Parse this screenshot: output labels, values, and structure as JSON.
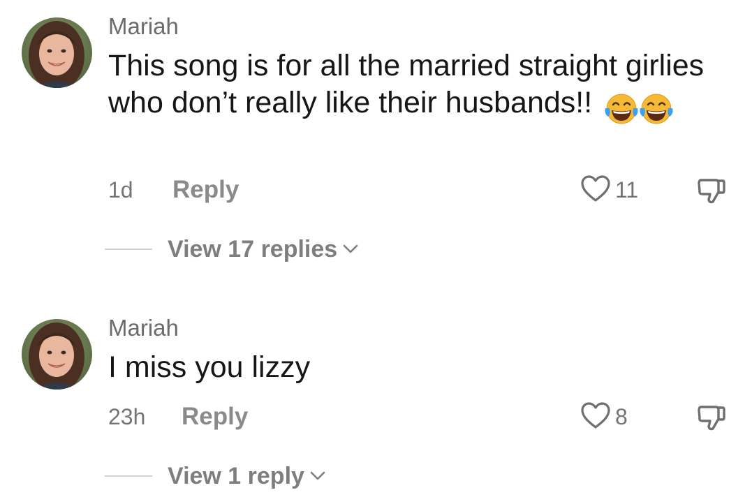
{
  "comments": [
    {
      "username": "Mariah",
      "text": "This song is for all the married straight girlies who don’t really like their husbands!!",
      "emojis": [
        "face-with-tears-of-joy",
        "face-with-tears-of-joy"
      ],
      "time": "1d",
      "reply_label": "Reply",
      "likes": "11",
      "view_replies": "View 17 replies"
    },
    {
      "username": "Mariah",
      "text": "I miss you lizzy",
      "time": "23h",
      "reply_label": "Reply",
      "likes": "8",
      "view_replies": "View 1 reply"
    }
  ],
  "colors": {
    "username": "#6b6b6b",
    "comment_text": "#161616",
    "meta": "#747474",
    "reply": "#8a8a8a",
    "divider": "#d2d2d2"
  }
}
